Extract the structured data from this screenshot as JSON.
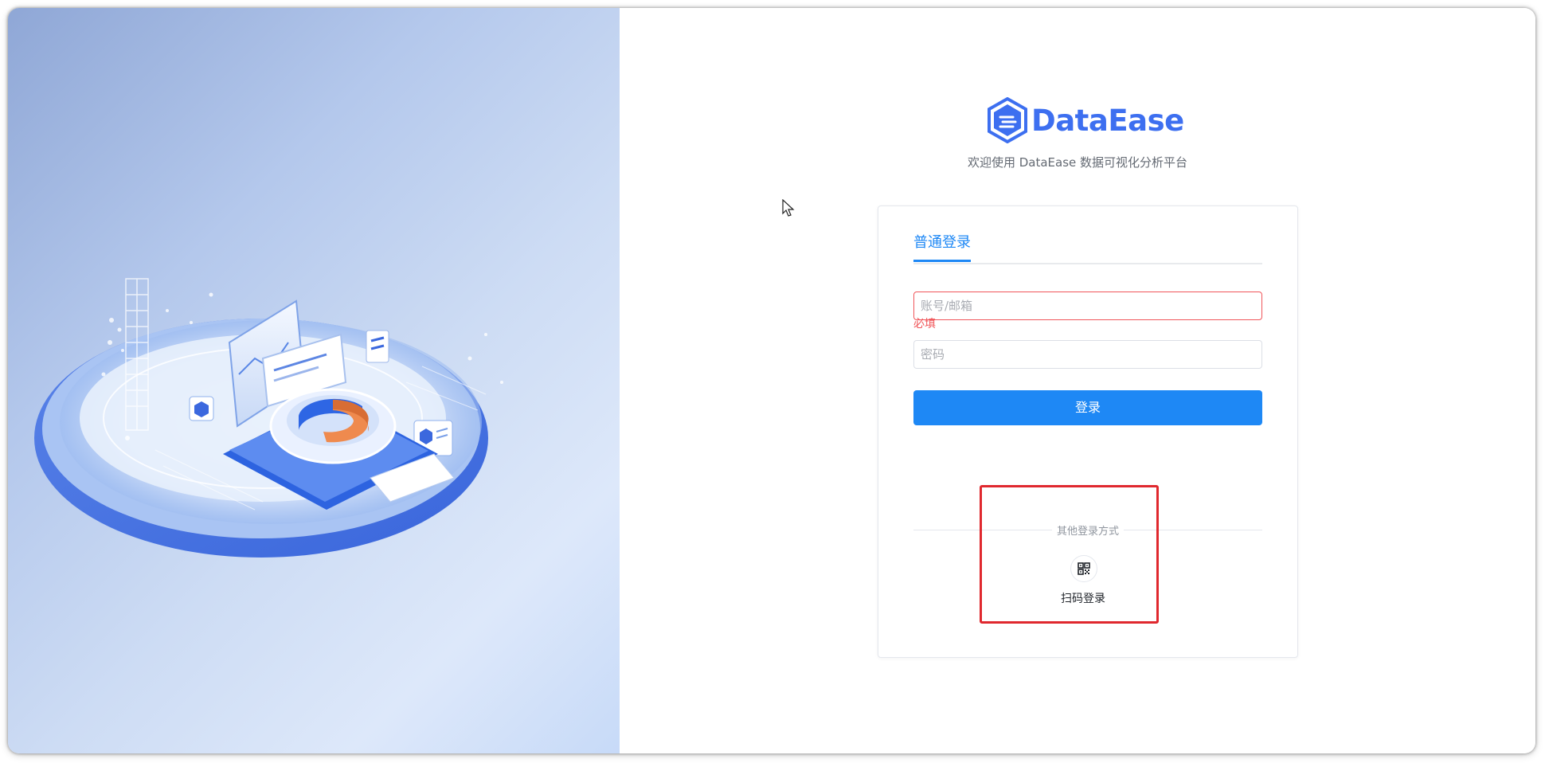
{
  "brand": {
    "name": "DataEase",
    "color": "#3d6ff0"
  },
  "welcome_text": "欢迎使用  DataEase  数据可视化分析平台",
  "login": {
    "tab_label": "普通登录",
    "account_placeholder": "账号/邮箱",
    "account_error": "必填",
    "password_placeholder": "密码",
    "submit_label": "登录",
    "primary_color": "#1e88f5",
    "error_color": "#f0565a"
  },
  "other_login": {
    "divider_label": "其他登录方式",
    "methods": [
      {
        "label": "扫码登录",
        "icon": "qr-code-icon"
      }
    ]
  },
  "highlight_color": "#e0282e"
}
